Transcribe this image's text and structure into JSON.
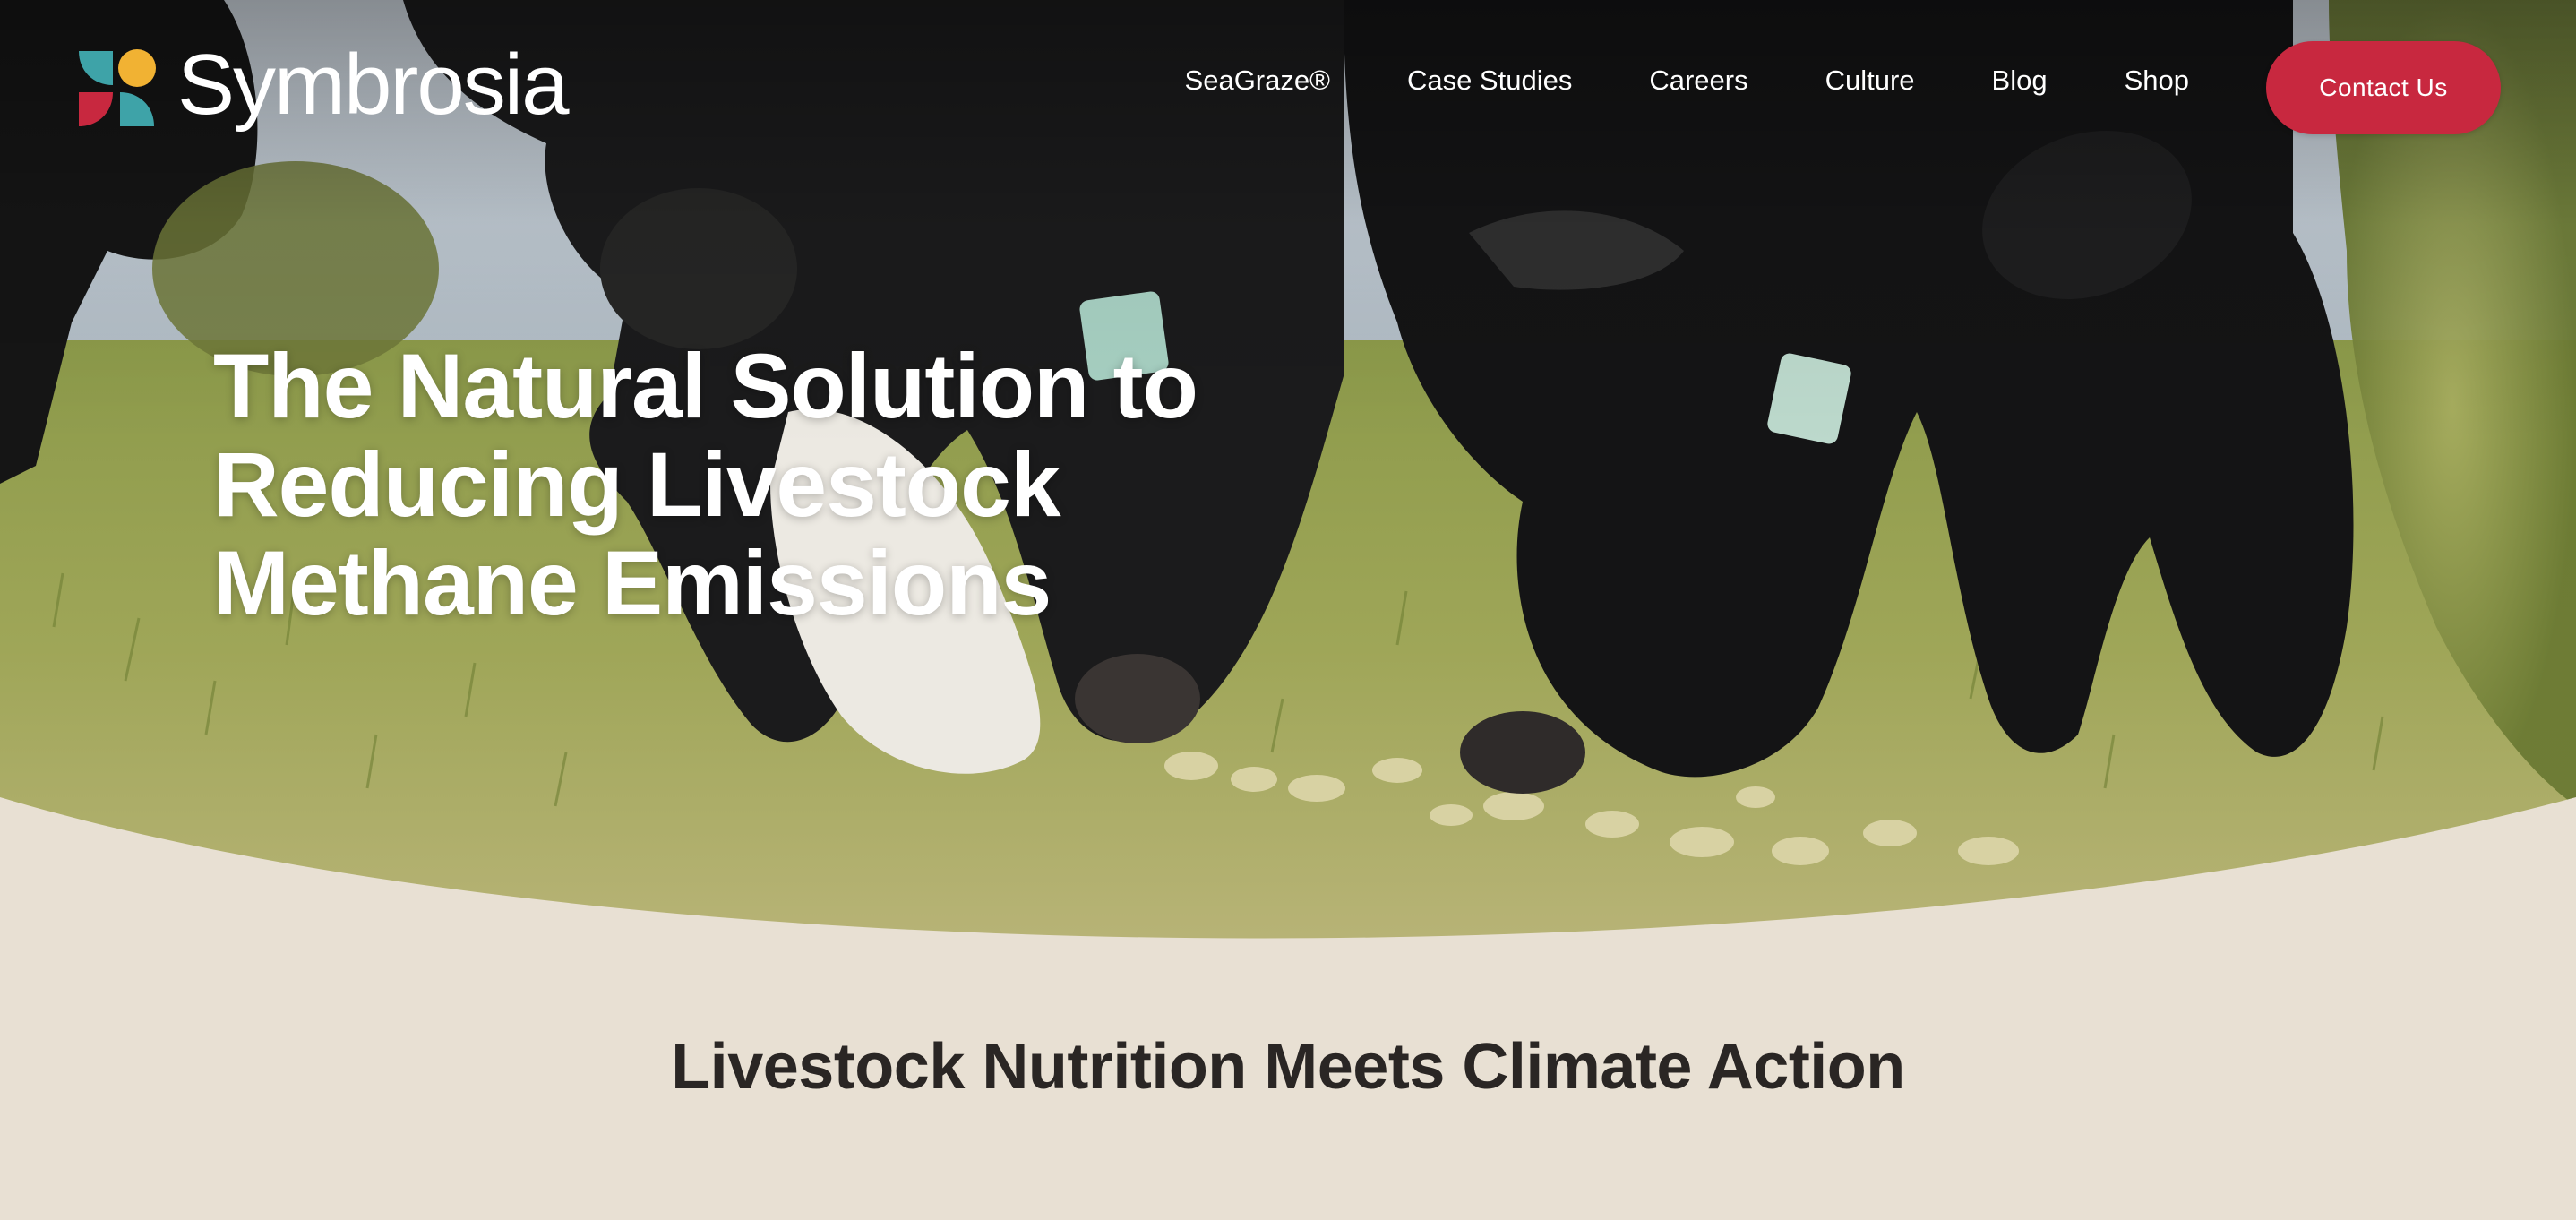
{
  "brand": {
    "name": "Symbrosia",
    "logo_colors": [
      "#3ea3a8",
      "#f1b233",
      "#c8283f",
      "#8a1f3d"
    ]
  },
  "nav": {
    "links": [
      {
        "label": "SeaGraze®"
      },
      {
        "label": "Case Studies"
      },
      {
        "label": "Careers"
      },
      {
        "label": "Culture"
      },
      {
        "label": "Blog"
      },
      {
        "label": "Shop"
      }
    ],
    "cta_label": "Contact Us"
  },
  "hero": {
    "headline_lines": [
      "The Natural Solution to",
      "Reducing Livestock",
      "Methane Emissions"
    ],
    "image_description": "cattle grazing"
  },
  "section": {
    "title": "Livestock Nutrition Meets Climate Action"
  },
  "colors": {
    "accent": "#c8283f",
    "background": "#e8e0d3",
    "heading_text": "#2a2624"
  }
}
